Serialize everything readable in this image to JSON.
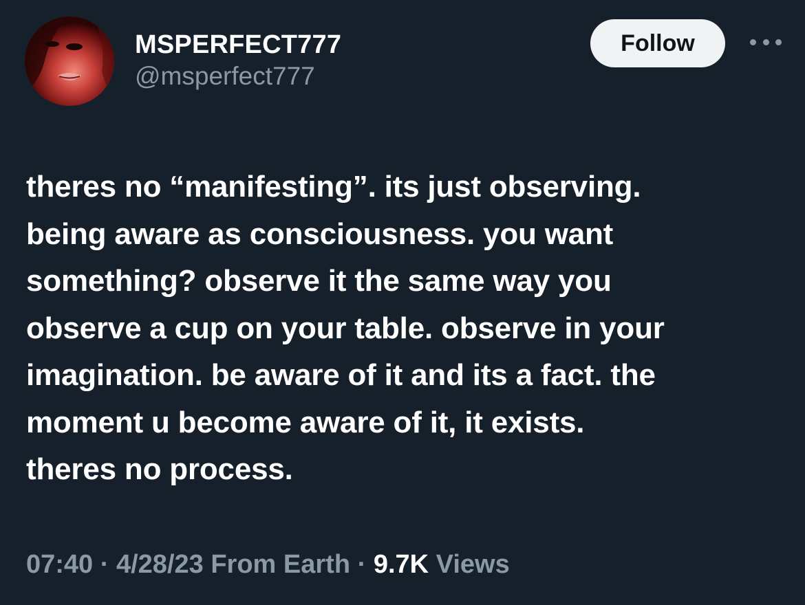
{
  "author": {
    "display_name": "MSPERFECT777",
    "handle": "@msperfect777"
  },
  "actions": {
    "follow_label": "Follow",
    "more_icon": "more-horizontal-icon"
  },
  "tweet": {
    "text": "theres no “manifesting”. its just observing.\nbeing aware as consciousness. you want\nsomething? observe it the same way you\nobserve a cup on your table. observe in your\nimagination. be aware of it and its a fact. the\nmoment u become aware of it, it exists.\ntheres no process."
  },
  "meta": {
    "time": "07:40",
    "separator": " · ",
    "date": "4/28/23",
    "source": "From Earth",
    "views_count": "9.7K",
    "views_label": "Views"
  },
  "colors": {
    "background": "#15202b",
    "text_primary": "#ffffff",
    "text_secondary": "#8b98a5",
    "follow_bg": "#eff3f4",
    "follow_text": "#0f1419"
  }
}
